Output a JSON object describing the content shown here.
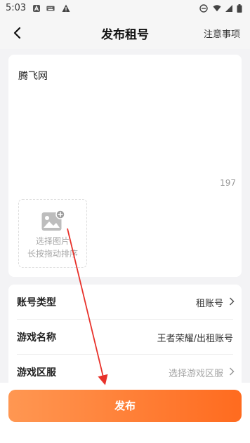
{
  "status_bar": {
    "time": "5:03",
    "icons": [
      "a-icon",
      "keyboard-icon",
      "warning-icon",
      "dnd-icon",
      "wifi-icon",
      "signal-icon",
      "battery-icon"
    ]
  },
  "navbar": {
    "title": "发布租号",
    "right_link": "注意事项",
    "back_icon": "back-arrow-icon"
  },
  "content": {
    "text": "腾飞网",
    "char_count": "197",
    "image_picker": {
      "line1": "选择图片",
      "line2": "长按拖动排序",
      "icon": "add-image-icon"
    }
  },
  "form": {
    "rows": [
      {
        "label": "账号类型",
        "value": "租账号"
      },
      {
        "label": "游戏名称",
        "value": "王者荣耀/出租账号"
      },
      {
        "label": "游戏区服",
        "value": "选择游戏区服"
      }
    ]
  },
  "footer": {
    "publish_label": "发布"
  },
  "colors": {
    "accent_start": "#ff9752",
    "accent_end": "#ff6b1f",
    "annotation": "#e8312a"
  }
}
